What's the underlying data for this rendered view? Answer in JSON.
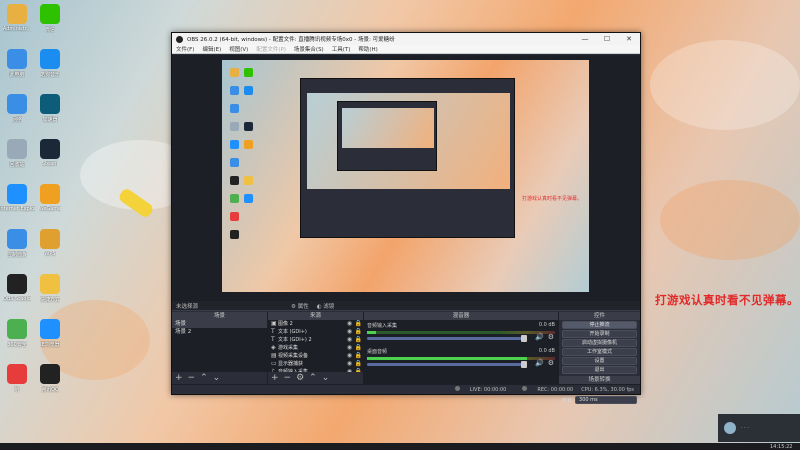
{
  "desktop": {
    "icons": [
      {
        "label": "Administr...",
        "icon": "user-folder-icon",
        "color": "#e8b040"
      },
      {
        "label": "微信",
        "icon": "wechat-icon",
        "color": "#2dc100"
      },
      {
        "label": "此电脑",
        "icon": "computer-icon",
        "color": "#3a8ee6"
      },
      {
        "label": "酷狗音乐",
        "icon": "kugou-icon",
        "color": "#1b8df0"
      },
      {
        "label": "网络",
        "icon": "network-icon",
        "color": "#3a8ee6"
      },
      {
        "label": "加速器",
        "icon": "accelerator-icon",
        "color": "#0d5c7a"
      },
      {
        "label": "回收站",
        "icon": "recycle-bin-icon",
        "color": "#9aa9b8"
      },
      {
        "label": "Steam",
        "icon": "steam-icon",
        "color": "#1b2838"
      },
      {
        "label": "Internet Explorer",
        "icon": "ie-icon",
        "color": "#1e90ff"
      },
      {
        "label": "WeGame",
        "icon": "wegame-icon",
        "color": "#f0a020"
      },
      {
        "label": "控制面板",
        "icon": "control-panel-icon",
        "color": "#3a8ee6"
      },
      {
        "label": "WPS",
        "icon": "wps-icon",
        "color": "#e0a030"
      },
      {
        "label": "OBS Studio",
        "icon": "obs-icon",
        "color": "#222222"
      },
      {
        "label": "快捷方式",
        "icon": "shortcut-icon",
        "color": "#f0c040"
      },
      {
        "label": "360安全",
        "icon": "security-360-icon",
        "color": "#4caf50"
      },
      {
        "label": "IE浏览器",
        "icon": "browser-icon",
        "color": "#1e90ff"
      },
      {
        "label": "听",
        "icon": "listen-app-icon",
        "color": "#e63c3c"
      },
      {
        "label": "腾讯QQ",
        "icon": "qq-icon",
        "color": "#222222"
      }
    ]
  },
  "obs": {
    "title": "OBS 26.0.2 (64-bit, windows) - 配置文件: 直播腾讯视频专场0x0 - 场景: 可爱糖纷",
    "menu": [
      "文件(F)",
      "编辑(E)",
      "视图(V)",
      "配置文件(P)",
      "场景集合(S)",
      "工具(T)",
      "帮助(H)"
    ],
    "preview_message": "打游戏认真时看不见弹幕。",
    "scene_bar": {
      "label": "未选择源",
      "props": "属性",
      "filters": "滤镜"
    },
    "scenes": {
      "header": "场景",
      "items": [
        "场景",
        "场景 2"
      ]
    },
    "sources": {
      "header": "来源",
      "items": [
        {
          "name": "图像 2",
          "icon": "image-icon",
          "glyph": "▣"
        },
        {
          "name": "文本 (GDI+)",
          "icon": "text-icon",
          "glyph": "T"
        },
        {
          "name": "文本 (GDI+) 2",
          "icon": "text-icon",
          "glyph": "T"
        },
        {
          "name": "游戏采集",
          "icon": "game-capture-icon",
          "glyph": "◈"
        },
        {
          "name": "视频采集设备",
          "icon": "camera-icon",
          "glyph": "▤"
        },
        {
          "name": "显示器捕获",
          "icon": "monitor-icon",
          "glyph": "▭"
        },
        {
          "name": "音频输入采集",
          "icon": "microphone-icon",
          "glyph": "♪"
        }
      ]
    },
    "mixer": {
      "header": "混音器",
      "channels": [
        {
          "name": "音频输入采集",
          "db": "0.0 dB",
          "level": 0.05
        },
        {
          "name": "桌面音频",
          "db": "0.0 dB",
          "level": 0.85
        }
      ]
    },
    "controls": {
      "header": "控件",
      "buttons": [
        "停止推流",
        "开始录制",
        "启动虚拟摄像机",
        "工作室模式",
        "设置",
        "退出"
      ]
    },
    "transitions": {
      "header": "场景转换",
      "selected": "淡出",
      "duration_label": "时长",
      "duration": "300 ms"
    },
    "status": {
      "live": "LIVE: 00:00:00",
      "rec": "REC: 00:00:00",
      "cpu": "CPU: 6.3%, 30.00 fps"
    }
  },
  "overlay_message": "打游戏认真时看不见弹幕。",
  "clock": "14:15:22",
  "colors": {
    "accent_red": "#e22a2a",
    "obs_bg": "#2b2e38",
    "meter_green": "#4cd24c"
  }
}
